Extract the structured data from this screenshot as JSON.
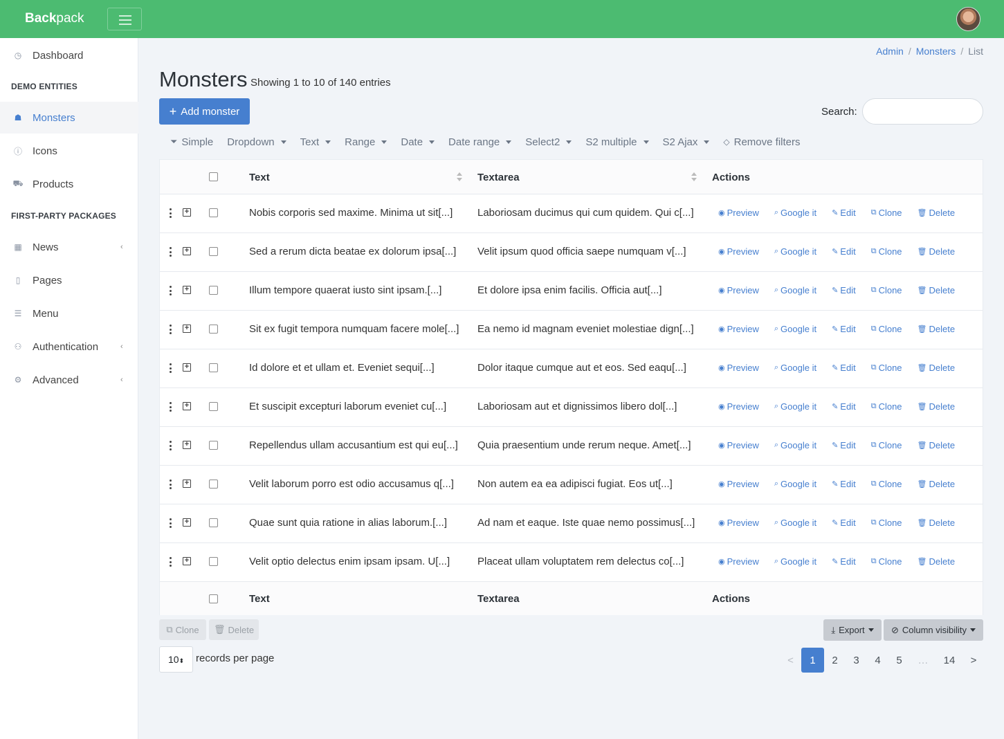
{
  "app": {
    "brand_bold": "Back",
    "brand_rest": "pack"
  },
  "sidebar": {
    "items": [
      {
        "label": "Dashboard",
        "icon": "dashboard-icon"
      },
      {
        "label": "Monsters",
        "icon": "monster-icon"
      },
      {
        "label": "Icons",
        "icon": "info-icon"
      },
      {
        "label": "Products",
        "icon": "cart-icon"
      },
      {
        "label": "News",
        "icon": "newspaper-icon"
      },
      {
        "label": "Pages",
        "icon": "file-icon"
      },
      {
        "label": "Menu",
        "icon": "list-icon"
      },
      {
        "label": "Authentication",
        "icon": "users-icon"
      },
      {
        "label": "Advanced",
        "icon": "cogs-icon"
      }
    ],
    "section_titles": [
      "DEMO ENTITIES",
      "FIRST-PARTY PACKAGES"
    ]
  },
  "breadcrumb": {
    "items": [
      "Admin",
      "Monsters",
      "List"
    ]
  },
  "page": {
    "title": "Monsters",
    "subtitle": "Showing 1 to 10 of 140 entries"
  },
  "toolbar": {
    "add_label": "Add monster",
    "search_label": "Search:",
    "search_value": ""
  },
  "filters": [
    "Simple",
    "Dropdown",
    "Text",
    "Range",
    "Date",
    "Date range",
    "Select2",
    "S2 multiple",
    "S2 Ajax",
    "Remove filters"
  ],
  "table": {
    "columns": [
      "Text",
      "Textarea",
      "Actions"
    ],
    "actions": [
      "Preview",
      "Google it",
      "Edit",
      "Clone",
      "Delete"
    ],
    "rows": [
      {
        "text": "Nobis corporis sed maxime. Minima ut sit[...]",
        "textarea": "Laboriosam ducimus qui cum quidem. Qui c[...]"
      },
      {
        "text": "Sed a rerum dicta beatae ex dolorum ipsa[...]",
        "textarea": "Velit ipsum quod officia saepe numquam v[...]"
      },
      {
        "text": "Illum tempore quaerat iusto sint ipsam.[...]",
        "textarea": "Et dolore ipsa enim facilis. Officia aut[...]"
      },
      {
        "text": "Sit ex fugit tempora numquam facere mole[...]",
        "textarea": "Ea nemo id magnam eveniet molestiae dign[...]"
      },
      {
        "text": "Id dolore et et ullam et. Eveniet sequi[...]",
        "textarea": "Dolor itaque cumque aut et eos. Sed eaqu[...]"
      },
      {
        "text": "Et suscipit excepturi laborum eveniet cu[...]",
        "textarea": "Laboriosam aut et dignissimos libero dol[...]"
      },
      {
        "text": "Repellendus ullam accusantium est qui eu[...]",
        "textarea": "Quia praesentium unde rerum neque. Amet[...]"
      },
      {
        "text": "Velit laborum porro est odio accusamus q[...]",
        "textarea": "Non autem ea ea adipisci fugiat. Eos ut[...]"
      },
      {
        "text": "Quae sunt quia ratione in alias laborum.[...]",
        "textarea": "Ad nam et eaque. Iste quae nemo possimus[...]"
      },
      {
        "text": "Velit optio delectus enim ipsam ipsam. U[...]",
        "textarea": "Placeat ullam voluptatem rem delectus co[...]"
      }
    ]
  },
  "bulk": {
    "clone_label": "Clone",
    "delete_label": "Delete"
  },
  "export": {
    "export_label": "Export",
    "visibility_label": "Column visibility"
  },
  "perpage": {
    "value": "10",
    "label": "records per page"
  },
  "pagination": {
    "prev": "<",
    "pages": [
      "1",
      "2",
      "3",
      "4",
      "5",
      "…",
      "14"
    ],
    "next": ">",
    "active": "1"
  },
  "colors": {
    "topbar": "#4cbb71",
    "primary": "#467fcf"
  }
}
